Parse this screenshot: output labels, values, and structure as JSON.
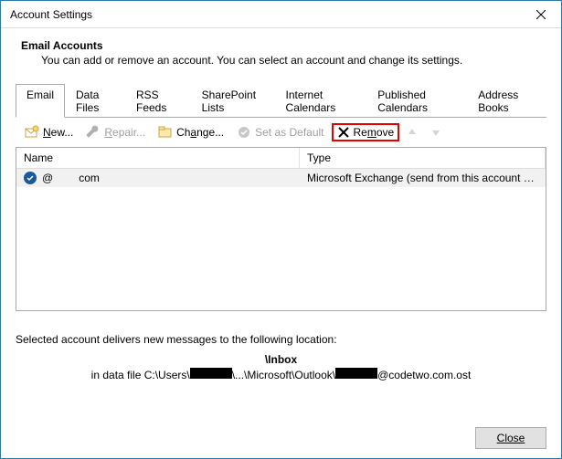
{
  "window": {
    "title": "Account Settings"
  },
  "header": {
    "heading": "Email Accounts",
    "sub": "You can add or remove an account. You can select an account and change its settings."
  },
  "tabs": [
    {
      "label": "Email",
      "active": true
    },
    {
      "label": "Data Files"
    },
    {
      "label": "RSS Feeds"
    },
    {
      "label": "SharePoint Lists"
    },
    {
      "label": "Internet Calendars"
    },
    {
      "label": "Published Calendars"
    },
    {
      "label": "Address Books"
    }
  ],
  "toolbar": {
    "new_pre": "N",
    "new_post": "ew...",
    "repair_pre": "R",
    "repair_post": "epair...",
    "change_pre": "Ch",
    "change_ul": "a",
    "change_post": "nge...",
    "default_label": "Set as Default",
    "remove_pre": "Re",
    "remove_ul": "m",
    "remove_post": "ove"
  },
  "table": {
    "columns": {
      "name": "Name",
      "type": "Type"
    },
    "rows": [
      {
        "name_part_a": "@",
        "name_part_b": "com",
        "type": "Microsoft Exchange (send from this account by def…",
        "is_default": true
      }
    ]
  },
  "location": {
    "text": "Selected account delivers new messages to the following location:",
    "inbox": "\\Inbox",
    "path_prefix": "in data file C:\\Users\\",
    "path_mid": "\\...\\Microsoft\\Outlook\\",
    "path_suffix": "@codetwo.com.ost"
  },
  "footer": {
    "close": "Close"
  }
}
